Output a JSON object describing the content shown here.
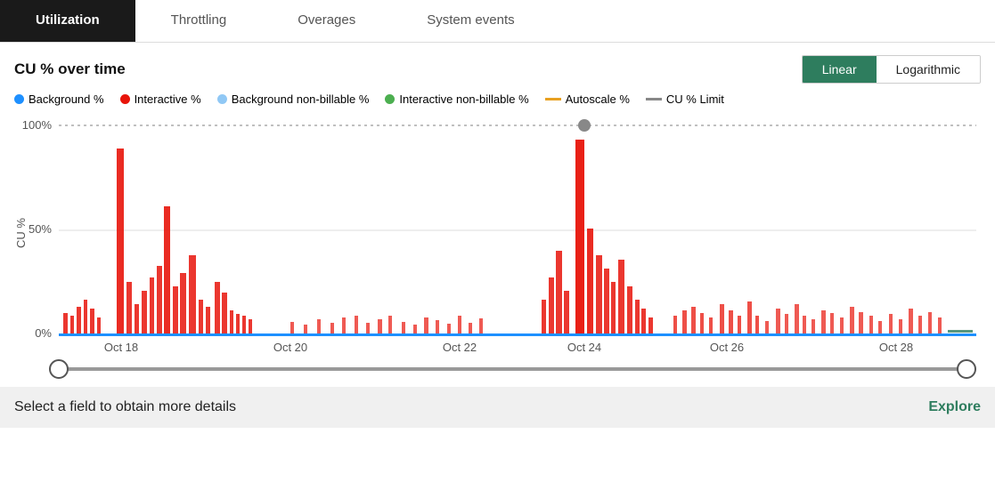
{
  "tabs": [
    {
      "label": "Utilization",
      "active": true
    },
    {
      "label": "Throttling",
      "active": false
    },
    {
      "label": "Overages",
      "active": false
    },
    {
      "label": "System events",
      "active": false
    }
  ],
  "chart": {
    "title": "CU % over time",
    "scale_linear": "Linear",
    "scale_logarithmic": "Logarithmic",
    "y_labels": [
      "100%",
      "50%",
      "0%"
    ],
    "x_labels": [
      "Oct 18",
      "Oct 20",
      "Oct 22",
      "Oct 24",
      "Oct 26",
      "Oct 28"
    ]
  },
  "legend": [
    {
      "label": "Background %",
      "color": "#1e90ff",
      "type": "dot"
    },
    {
      "label": "Interactive %",
      "color": "#e8140a",
      "type": "dot"
    },
    {
      "label": "Background non-billable %",
      "color": "#90c8f5",
      "type": "dot"
    },
    {
      "label": "Interactive non-billable %",
      "color": "#4caf50",
      "type": "dot"
    },
    {
      "label": "Autoscale %",
      "color": "#e8a020",
      "type": "line"
    },
    {
      "label": "CU % Limit",
      "color": "#888",
      "type": "line"
    }
  ],
  "bottom": {
    "text": "Select a field to obtain more details",
    "explore": "Explore"
  }
}
